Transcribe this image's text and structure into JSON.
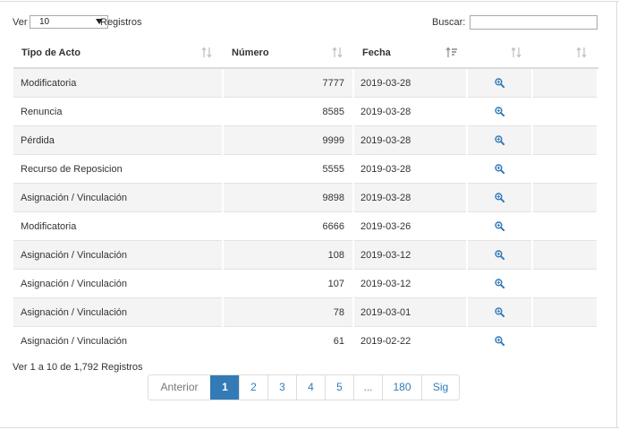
{
  "length_control": {
    "prefix": "Ver",
    "value": "10",
    "suffix": "Registros"
  },
  "search": {
    "label": "Buscar:",
    "value": ""
  },
  "table": {
    "headers": [
      "Tipo de Acto",
      "Número",
      "Fecha",
      "",
      ""
    ],
    "rows": [
      {
        "tipo": "Modificatoria",
        "numero": "7777",
        "fecha": "2019-03-28"
      },
      {
        "tipo": "Renuncia",
        "numero": "8585",
        "fecha": "2019-03-28"
      },
      {
        "tipo": "Pérdida",
        "numero": "9999",
        "fecha": "2019-03-28"
      },
      {
        "tipo": "Recurso de Reposicion",
        "numero": "5555",
        "fecha": "2019-03-28"
      },
      {
        "tipo": "Asignación / Vinculación",
        "numero": "9898",
        "fecha": "2019-03-28"
      },
      {
        "tipo": "Modificatoria",
        "numero": "6666",
        "fecha": "2019-03-26"
      },
      {
        "tipo": "Asignación / Vinculación",
        "numero": "108",
        "fecha": "2019-03-12"
      },
      {
        "tipo": "Asignación / Vinculación",
        "numero": "107",
        "fecha": "2019-03-12"
      },
      {
        "tipo": "Asignación / Vinculación",
        "numero": "78",
        "fecha": "2019-03-01"
      },
      {
        "tipo": "Asignación / Vinculación",
        "numero": "61",
        "fecha": "2019-02-22"
      }
    ],
    "row_action_icon": "magnifier-plus-icon",
    "sort_icon": "sort-arrows-icon",
    "sort_active_icon": "sort-descending-icon"
  },
  "info": "Ver 1 a 10 de 1,792 Registros",
  "pagination": {
    "previous": "Anterior",
    "pages": [
      "1",
      "2",
      "3",
      "4",
      "5",
      "...",
      "180"
    ],
    "next": "Sig",
    "current": "1"
  },
  "colors": {
    "accent": "#337ab7",
    "stripe": "#f4f4f4",
    "border": "#dcdcdc"
  }
}
